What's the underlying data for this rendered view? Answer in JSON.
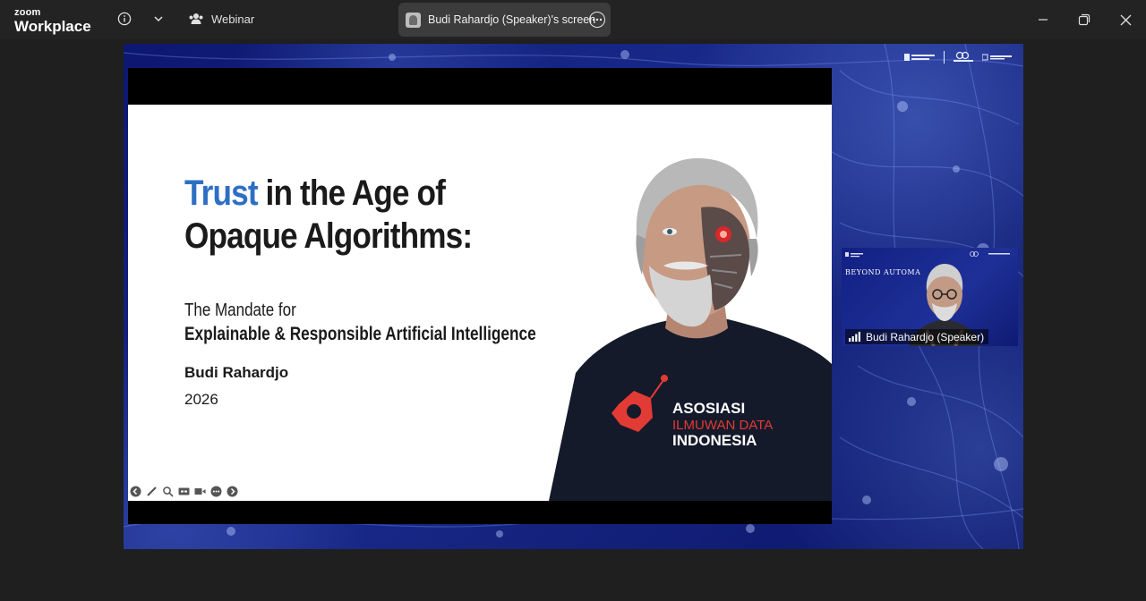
{
  "titlebar": {
    "logo_top": "zoom",
    "logo_bottom": "Workplace",
    "webinar_label": "Webinar",
    "share_label": "Budi Rahardjo (Speaker)'s screen",
    "icons": [
      "info-icon",
      "chevron-down-icon",
      "people-icon",
      "more-icon",
      "minimize-icon",
      "restore-icon",
      "close-icon"
    ]
  },
  "slide": {
    "title_accent": "Trust",
    "title_line1_rest": " in the Age of",
    "title_line2": "Opaque Algorithms:",
    "subtitle_line1": "The Mandate for",
    "subtitle_line2": "Explainable & Responsible Artificial Intelligence",
    "author": "Budi Rahardjo",
    "year": "2026",
    "shirt_line1": "ASOSIASI",
    "shirt_line2": "ILMUWAN DATA",
    "shirt_line3": "INDONESIA",
    "accent_color": "#2e6fc4"
  },
  "speaker_video": {
    "name_label": "Budi Rahardjo (Speaker)",
    "banner_text": "BEYOND AUTOMA"
  }
}
